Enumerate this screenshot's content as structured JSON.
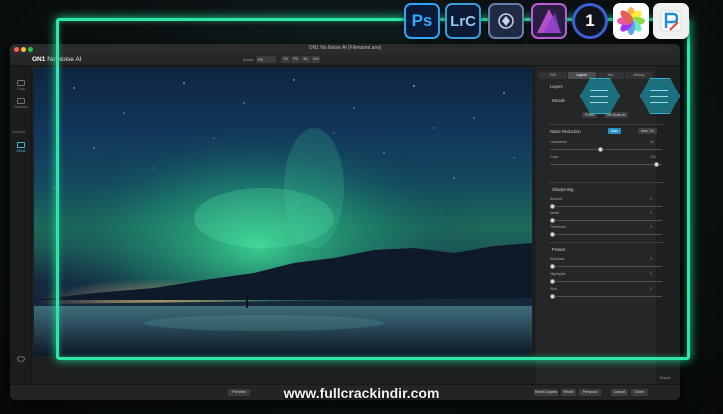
{
  "window": {
    "title": "ON1 No Noise AI (Filename.arw)",
    "brand_prefix": "ON1",
    "brand_name": "No Noise AI"
  },
  "toolbar": {
    "zoom_label": "Zoom",
    "zoom_value": "Fill",
    "zoom_buttons": [
      "Fit",
      "Fill",
      "50",
      "100"
    ]
  },
  "left_sidebar": {
    "items": [
      {
        "label": "Crop",
        "icon": "crop-icon"
      },
      {
        "label": "Retouch",
        "icon": "brush-icon"
      },
      {
        "label": "Masks",
        "icon": "mask-icon"
      },
      {
        "label": "Detail",
        "icon": "detail-icon"
      }
    ],
    "section_label": "Masking"
  },
  "right_panel": {
    "tabs": [
      "Edit",
      "Layers",
      "Info",
      "History"
    ],
    "active_tab": "Layers",
    "layers_label": "Layers",
    "details_label": "Details",
    "mode_chips": [
      "Photo",
      "No Noise AI"
    ],
    "noise_reduction": {
      "title": "Noise Reduction",
      "auto_label": "Auto",
      "auto_on_label": "Auto On",
      "sliders": [
        {
          "label": "Luminance",
          "value": "46",
          "level": 0.45
        },
        {
          "label": "Color",
          "value": "100",
          "level": 0.95
        }
      ]
    },
    "sharpening": {
      "title": "Sharpening",
      "sliders": [
        {
          "label": "Amount",
          "value": "0",
          "level": 0.02
        },
        {
          "label": "Detail",
          "value": "0",
          "level": 0.02
        },
        {
          "label": "Threshold",
          "value": "0",
          "level": 0.02
        }
      ]
    },
    "protect": {
      "title": "Protect",
      "sliders": [
        {
          "label": "Shadows",
          "value": "0",
          "level": 0.02
        },
        {
          "label": "Highlights",
          "value": "0",
          "level": 0.02
        },
        {
          "label": "Skin",
          "value": "0",
          "level": 0.02
        }
      ]
    }
  },
  "bottom_bar": {
    "preview_label": "Preview",
    "reset_layers_label": "Reset Layers",
    "reset_label": "Reset",
    "previous_label": "Previous",
    "cancel_label": "Cancel",
    "done_label": "Done",
    "export_label": "Export"
  },
  "app_icons": [
    {
      "label": "Ps",
      "icon": "photoshop-icon"
    },
    {
      "label": "LrC",
      "icon": "lightroom-classic-icon"
    },
    {
      "label": "",
      "icon": "affinity-icon"
    },
    {
      "label": "",
      "icon": "affinity-photo-icon"
    },
    {
      "label": "1",
      "icon": "capture-one-icon"
    },
    {
      "label": "",
      "icon": "apple-photos-icon"
    },
    {
      "label": "",
      "icon": "pixelmator-icon"
    }
  ],
  "watermark": "www.fullcrackindir.com",
  "colors": {
    "accent_glow": "#2ee6a8",
    "panel_bg": "#252627",
    "active_blue": "#2b8fc4"
  }
}
